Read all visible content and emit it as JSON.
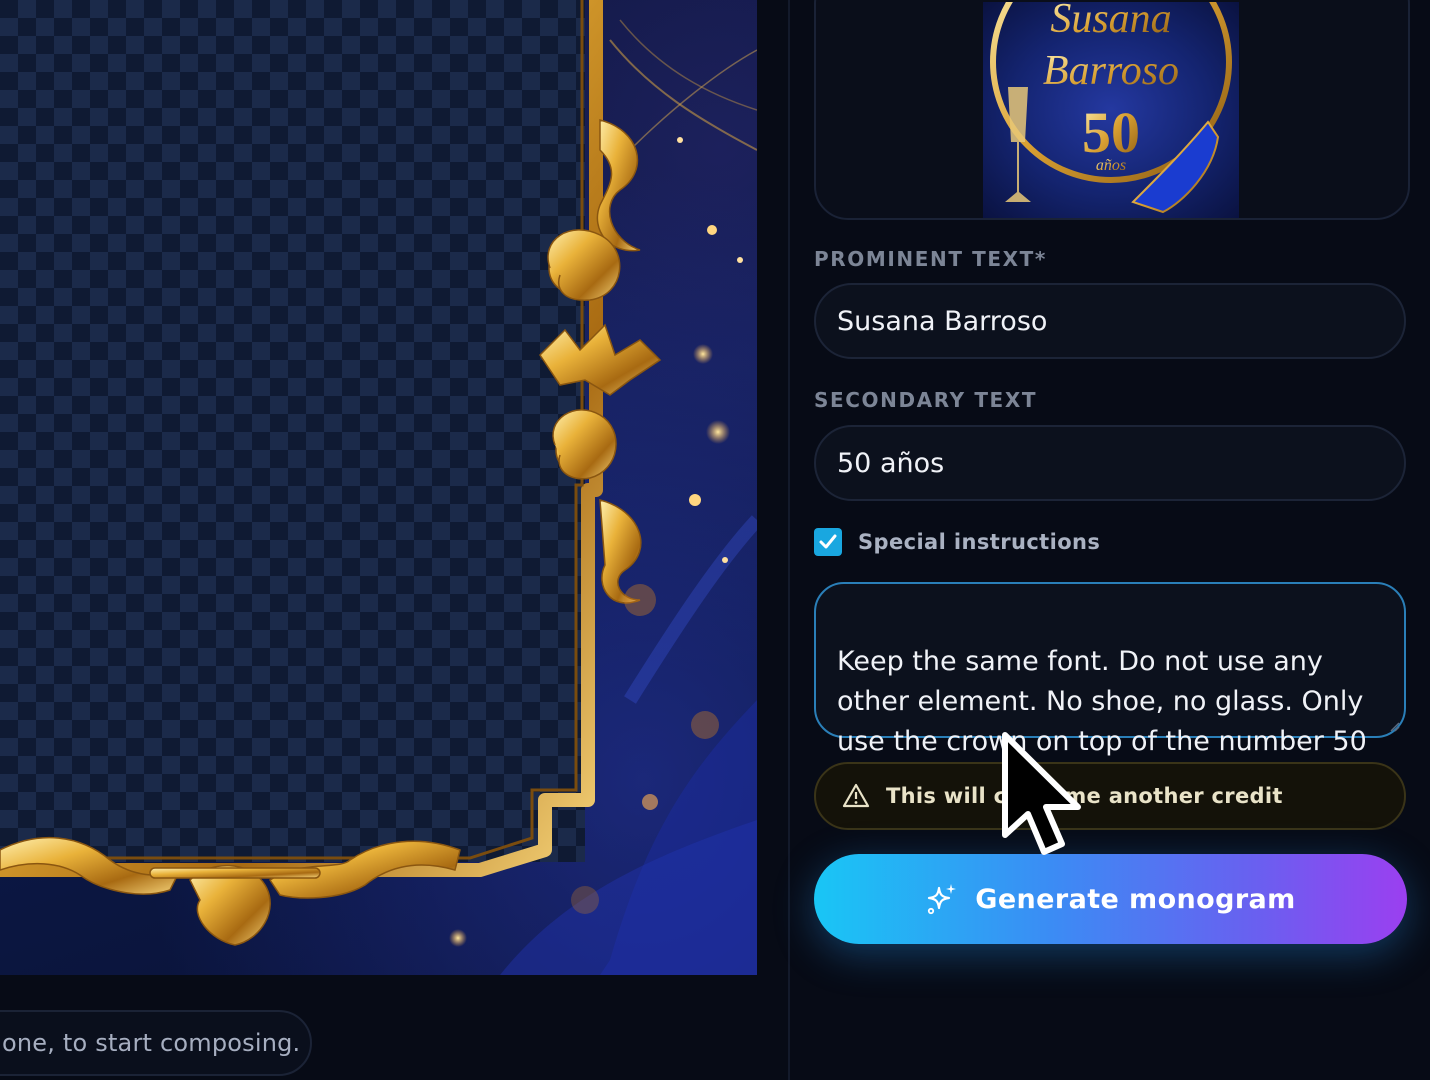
{
  "canvas": {
    "hint_text": "one, to start composing."
  },
  "preview": {
    "name_line1": "Susana",
    "name_line2": "Barroso",
    "number": "50",
    "sub": "años"
  },
  "form": {
    "prominent_label": "PROMINENT TEXT*",
    "prominent_value": "Susana Barroso",
    "secondary_label": "SECONDARY TEXT",
    "secondary_value": "50 años",
    "special_checkbox_label": "Special instructions",
    "special_checked": true,
    "special_value": "Keep the same font. Do not use any other element. No shoe, no glass. Only use the crown on top of the number 50",
    "warning_text": "This will consume another credit",
    "generate_label": "Generate monogram"
  },
  "icons": {
    "check": "check-icon",
    "warning": "warning-triangle-icon",
    "sparkle": "sparkle-icon",
    "cursor": "mouse-cursor-icon"
  },
  "colors": {
    "accent_start": "#19c6f5",
    "accent_end": "#9b3ff0",
    "gold": "#e9b23a",
    "background": "#070b16"
  }
}
